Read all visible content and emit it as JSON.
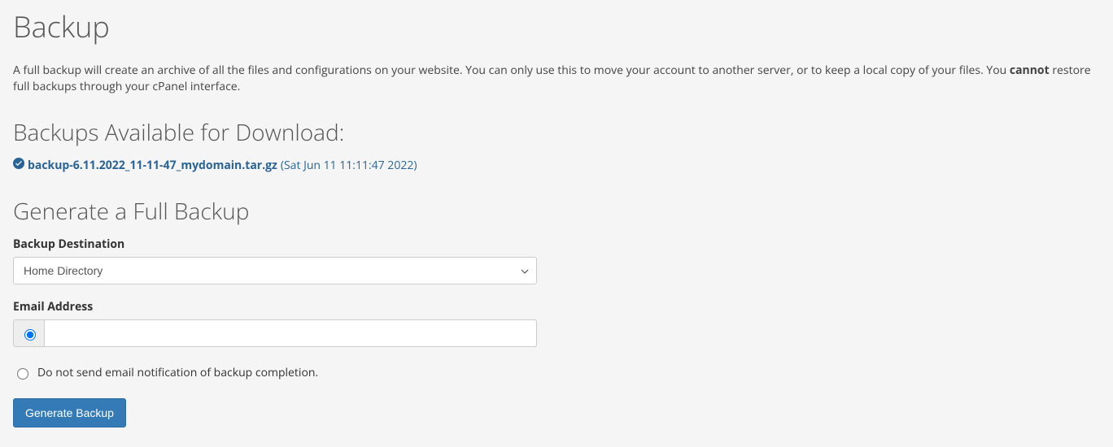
{
  "page": {
    "title": "Backup",
    "desc_pre": "A full backup will create an archive of all the files and configurations on your website. You can only use this to move your account to another server, or to keep a local copy of your files. You ",
    "desc_strong": "cannot",
    "desc_post": " restore full backups through your cPanel interface."
  },
  "available": {
    "heading": "Backups Available for Download:",
    "items": [
      {
        "filename": "backup-6.11.2022_11-11-47_mydomain.tar.gz",
        "date": "(Sat Jun 11 11:11:47 2022)"
      }
    ]
  },
  "generate": {
    "heading": "Generate a Full Backup",
    "dest_label": "Backup Destination",
    "dest_value": "Home Directory",
    "email_label": "Email Address",
    "email_value": "",
    "no_email_label": "Do not send email notification of backup completion.",
    "button_label": "Generate Backup"
  }
}
